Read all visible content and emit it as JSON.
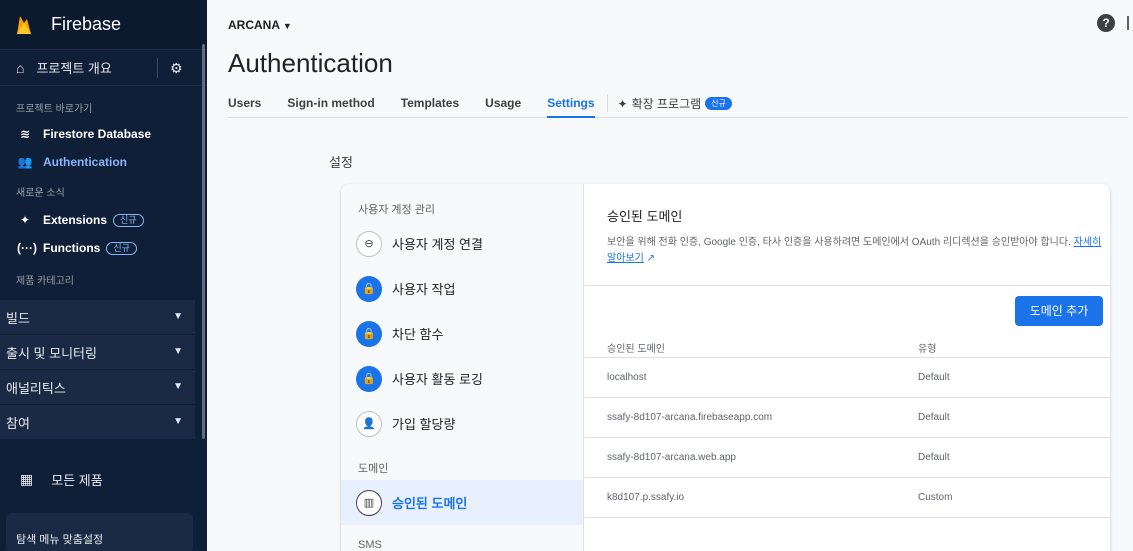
{
  "sidebar": {
    "brand": "Firebase",
    "overview": "프로젝트 개요",
    "shortcuts_title": "프로젝트 바로가기",
    "shortcuts": [
      {
        "label": "Firestore Database",
        "icon": "wifi-icon"
      },
      {
        "label": "Authentication",
        "icon": "users-icon"
      }
    ],
    "news_title": "새로운 소식",
    "news": [
      {
        "label": "Extensions",
        "badge": "신규",
        "icon": "extensions-icon"
      },
      {
        "label": "Functions",
        "badge": "신규",
        "icon": "functions-icon"
      }
    ],
    "categories_title": "제품 카테고리",
    "categories": [
      "빌드",
      "출시 및 모니터링",
      "애널리틱스",
      "참여"
    ],
    "all_products": "모든 제품",
    "tip": "탐색 메뉴 맞춤설정"
  },
  "header": {
    "project": "ARCANA",
    "title": "Authentication",
    "tabs": [
      "Users",
      "Sign-in method",
      "Templates",
      "Usage",
      "Settings"
    ],
    "extension_tab": "확장 프로그램",
    "extension_badge": "신규",
    "help": "?"
  },
  "settings_label": "설정",
  "nav": {
    "user_section": "사용자 계정 관리",
    "items": [
      {
        "label": "사용자 계정 연결",
        "icon": "link-icon"
      },
      {
        "label": "사용자 작업",
        "icon": "lock-icon"
      },
      {
        "label": "차단 함수",
        "icon": "lock-icon"
      },
      {
        "label": "사용자 활동 로깅",
        "icon": "lock-icon"
      },
      {
        "label": "가입 할당량",
        "icon": "user-settings-icon"
      }
    ],
    "domain_section": "도메인",
    "domain_item": "승인된 도메인",
    "sms_section": "SMS"
  },
  "content": {
    "heading": "승인된 도메인",
    "desc": "보안을 위해 전화 인증, Google 인증, 타사 인증을 사용하려면 도메인에서 OAuth 리디렉션을 승인받아야 합니다.",
    "learn_more": "자세히 알아보기",
    "add_button": "도메인 추가",
    "col_domain": "승인된 도메인",
    "col_type": "유형",
    "rows": [
      {
        "domain": "localhost",
        "type": "Default"
      },
      {
        "domain": "ssafy-8d107-arcana.firebaseapp.com",
        "type": "Default"
      },
      {
        "domain": "ssafy-8d107-arcana.web.app",
        "type": "Default"
      },
      {
        "domain": "k8d107.p.ssafy.io",
        "type": "Custom"
      }
    ]
  },
  "colors": {
    "accent": "#1a73e8",
    "sidebar": "#0f1f38",
    "flame": "#ffa000"
  }
}
